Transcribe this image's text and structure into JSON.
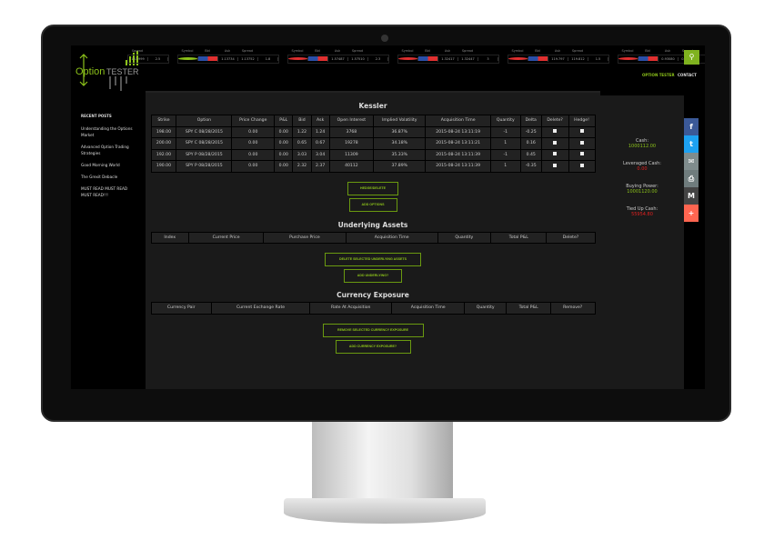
{
  "brand": {
    "logo_text_1": "Option",
    "logo_text_2": "TESTER"
  },
  "ticker": {
    "headers": [
      "Symbol",
      "Bid",
      "Ask",
      "Spread"
    ],
    "groups": [
      {
        "partial": true,
        "header": "Spread",
        "values": [
          "137.999",
          "2.5"
        ]
      },
      {
        "dot": "#8cc21a",
        "values": [
          "1.13734",
          "1.13752",
          "1.8"
        ]
      },
      {
        "dot": "#e03030",
        "values": [
          "1.57487",
          "1.57510",
          "2.3"
        ]
      },
      {
        "dot": "#e03030",
        "values": [
          "1.32417",
          "1.32447",
          "3"
        ]
      },
      {
        "dot": "#e03030",
        "values": [
          "119.797",
          "119.812",
          "1.5"
        ]
      },
      {
        "dot": "#e03030",
        "values": [
          "0.93080",
          "0.93009",
          "2.9"
        ]
      }
    ]
  },
  "nav": {
    "option_tester": "OPTION TESTER",
    "contact": "CONTACT"
  },
  "sidebar": {
    "title": "RECENT POSTS",
    "posts": [
      "Understanding the Options Market",
      "Advanced Option Trading Strategies",
      "Good Morning World",
      "The Grexit Debacle",
      "MUST READ MUST READ MUST READ!!!"
    ]
  },
  "options": {
    "title": "Kessler",
    "headers": [
      "Strike",
      "Option",
      "Price Change",
      "P&L",
      "Bid",
      "Ask",
      "Open Interest",
      "Implied Volatility",
      "Acquisition Time",
      "Quantity",
      "Delta",
      "Delete?",
      "Hedge!"
    ],
    "rows": [
      [
        "198.00",
        "SPY C 08/28/2015",
        "0.00",
        "0.00",
        "1.22",
        "1.24",
        "3768",
        "36.87%",
        "2015-08-24 13:11:19",
        "-1",
        "-0.25"
      ],
      [
        "200.00",
        "SPY C 08/28/2015",
        "0.00",
        "0.00",
        "0.65",
        "0.67",
        "19278",
        "34.18%",
        "2015-08-24 13:11:21",
        "1",
        "0.16"
      ],
      [
        "192.00",
        "SPY P 08/28/2015",
        "0.00",
        "0.00",
        "3.03",
        "3.04",
        "11309",
        "35.33%",
        "2015-08-24 13:11:39",
        "-1",
        "0.45"
      ],
      [
        "190.00",
        "SPY P 08/28/2015",
        "0.00",
        "0.00",
        "2.32",
        "2.37",
        "40112",
        "37.89%",
        "2015-08-24 13:11:39",
        "1",
        "-0.35"
      ]
    ],
    "hedge_delete": "HEDGE/DELETE",
    "add_options": "ADD OPTIONS"
  },
  "underlying": {
    "title": "Underlying Assets",
    "headers": [
      "Index",
      "Current Price",
      "Purchase Price",
      "Acquisition Time",
      "Quantity",
      "Total P&L",
      "Delete?"
    ],
    "delete_btn": "DELETE SELECTED UNDERLYING ASSETS",
    "add_btn": "ADD UNDERLYING?"
  },
  "currency": {
    "title": "Currency Exposure",
    "headers": [
      "Currency Pair",
      "Current Exchange Rate",
      "Rate At Acquisition",
      "Acquisition Time",
      "Quantity",
      "Total P&L",
      "Remove?"
    ],
    "remove_btn": "REMOVE SELECTED CURRENCY EXPOSURE",
    "add_btn": "ADD CURRENCY EXPOSURE?"
  },
  "account": [
    {
      "label": "Cash:",
      "value": "1000112.00",
      "color": "#8cc21a"
    },
    {
      "label": "Leveraged Cash:",
      "value": "0.00",
      "color": "#e02020"
    },
    {
      "label": "Buying Power:",
      "value": "10001120.00",
      "color": "#8cc21a"
    },
    {
      "label": "Tied Up Cash:",
      "value": "55954.80",
      "color": "#e02020"
    }
  ],
  "share": [
    {
      "icon": "facebook-icon",
      "glyph": "f",
      "color": "#3b5998"
    },
    {
      "icon": "twitter-icon",
      "glyph": "t",
      "color": "#1da1f2"
    },
    {
      "icon": "email-icon",
      "glyph": "✉",
      "color": "#7f8c8d"
    },
    {
      "icon": "print-icon",
      "glyph": "⎙",
      "color": "#6f7c7d"
    },
    {
      "icon": "gmail-icon",
      "glyph": "M",
      "color": "#444"
    },
    {
      "icon": "plus-icon",
      "glyph": "+",
      "color": "#ff6550"
    }
  ]
}
